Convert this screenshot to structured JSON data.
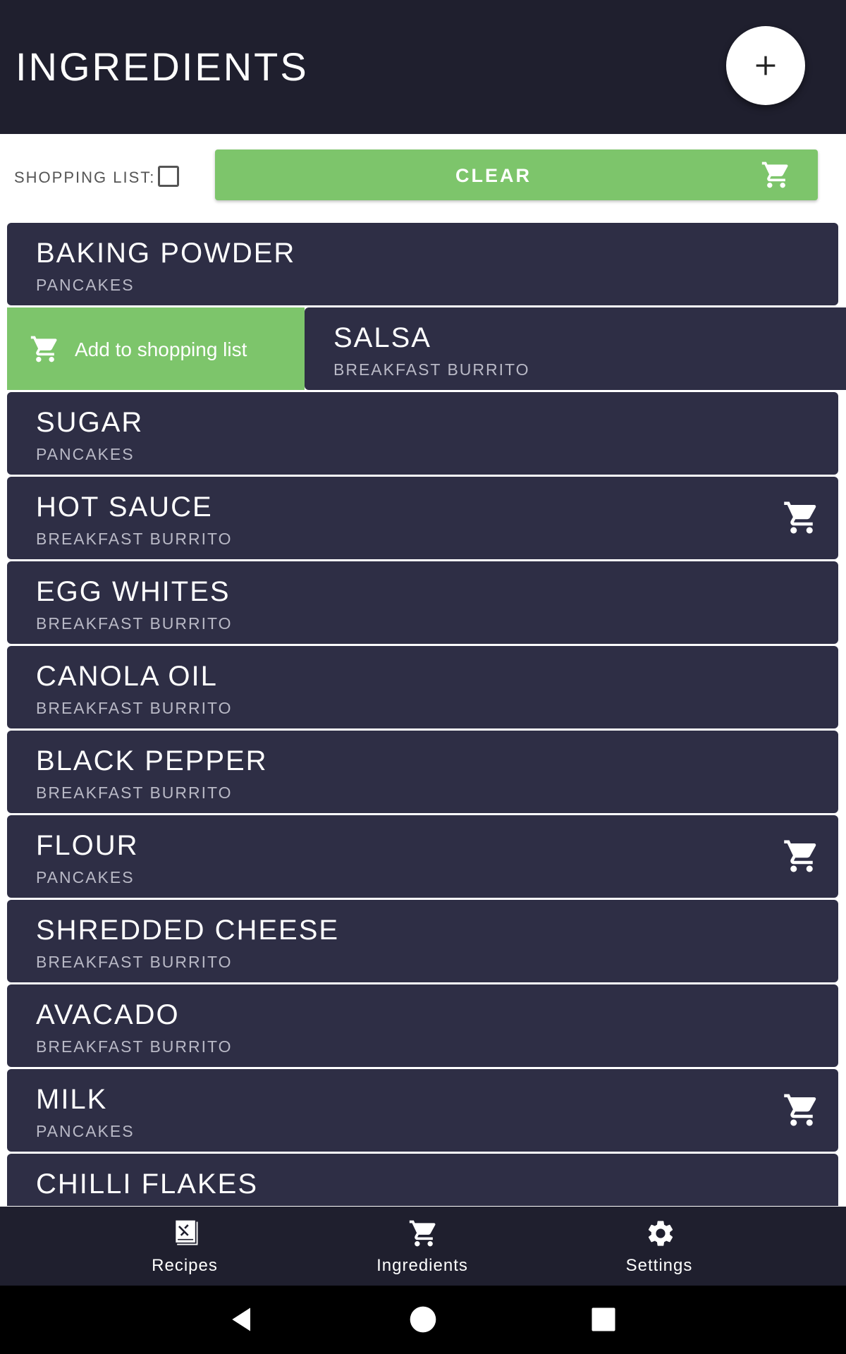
{
  "header": {
    "title": "INGREDIENTS",
    "add_icon": "plus-icon"
  },
  "controls": {
    "shopping_list_label": "SHOPPING LIST:",
    "shopping_list_checked": false,
    "clear_label": "CLEAR",
    "clear_icon": "cart-icon"
  },
  "swipe_action": {
    "label": "Add to shopping list",
    "icon": "cart-icon"
  },
  "ingredients": [
    {
      "name": "BAKING POWDER",
      "recipe": "PANCAKES",
      "in_cart": false,
      "swiped": false
    },
    {
      "name": "SALSA",
      "recipe": "BREAKFAST BURRITO",
      "in_cart": false,
      "swiped": true
    },
    {
      "name": "SUGAR",
      "recipe": "PANCAKES",
      "in_cart": false,
      "swiped": false
    },
    {
      "name": "HOT SAUCE",
      "recipe": "BREAKFAST BURRITO",
      "in_cart": true,
      "swiped": false
    },
    {
      "name": "EGG WHITES",
      "recipe": "BREAKFAST BURRITO",
      "in_cart": false,
      "swiped": false
    },
    {
      "name": "CANOLA OIL",
      "recipe": "BREAKFAST BURRITO",
      "in_cart": false,
      "swiped": false
    },
    {
      "name": "BLACK PEPPER",
      "recipe": "BREAKFAST BURRITO",
      "in_cart": false,
      "swiped": false
    },
    {
      "name": "FLOUR",
      "recipe": "PANCAKES",
      "in_cart": true,
      "swiped": false
    },
    {
      "name": "SHREDDED CHEESE",
      "recipe": "BREAKFAST BURRITO",
      "in_cart": false,
      "swiped": false
    },
    {
      "name": "AVACADO",
      "recipe": "BREAKFAST BURRITO",
      "in_cart": false,
      "swiped": false
    },
    {
      "name": "MILK",
      "recipe": "PANCAKES",
      "in_cart": true,
      "swiped": false
    },
    {
      "name": "CHILLI FLAKES",
      "recipe": "",
      "in_cart": false,
      "swiped": false
    }
  ],
  "bottom_nav": {
    "items": [
      {
        "label": "Recipes",
        "icon": "recipe-book-icon"
      },
      {
        "label": "Ingredients",
        "icon": "cart-icon"
      },
      {
        "label": "Settings",
        "icon": "gear-icon"
      }
    ]
  },
  "system_nav": {
    "back_icon": "back-triangle-icon",
    "home_icon": "home-circle-icon",
    "recents_icon": "recents-square-icon"
  },
  "colors": {
    "header_bg": "#1f1f2e",
    "card_bg": "#2e2e45",
    "accent_green": "#7dc56b",
    "subtitle": "#b9b9c6"
  }
}
